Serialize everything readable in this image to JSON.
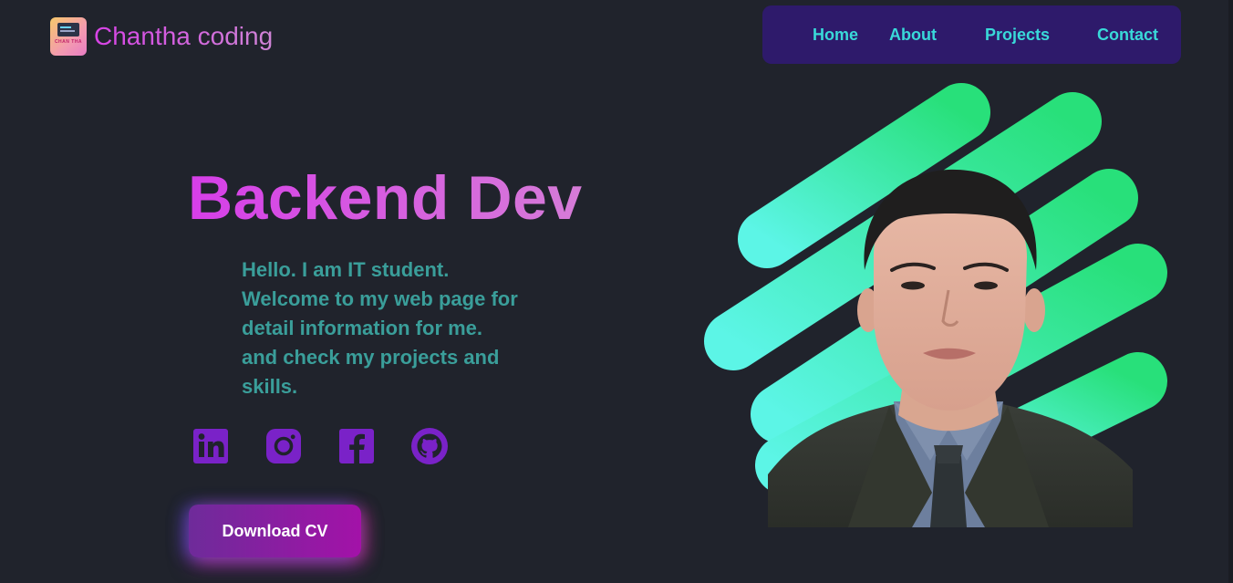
{
  "header": {
    "brand_name": "Chantha coding",
    "logo_text": "CHAN THA",
    "nav": {
      "home": "Home",
      "about": "About",
      "projects": "Projects",
      "contact": "Contact"
    }
  },
  "hero": {
    "title": "Backend Dev",
    "intro_lines": [
      "Hello. I am IT student.",
      "Welcome to my web page for",
      "detail information for me.",
      "and check my projects and",
      "skills."
    ],
    "socials": [
      {
        "name": "linkedin-icon"
      },
      {
        "name": "instagram-icon"
      },
      {
        "name": "facebook-icon"
      },
      {
        "name": "github-icon"
      }
    ],
    "cv_button": "Download CV"
  },
  "colors": {
    "background": "#20232c",
    "nav_bg": "#2e1a6b",
    "nav_text": "#39d9d9",
    "title_gradient": [
      "#d63ee8",
      "#d67cd8"
    ],
    "intro_text": "#3a9e9a",
    "social_icon": "#7a22c8",
    "stripe_gradient": [
      "#5cf5e6",
      "#28e07a"
    ],
    "button_gradient": [
      "#6e2b9a",
      "#a312a8"
    ]
  }
}
